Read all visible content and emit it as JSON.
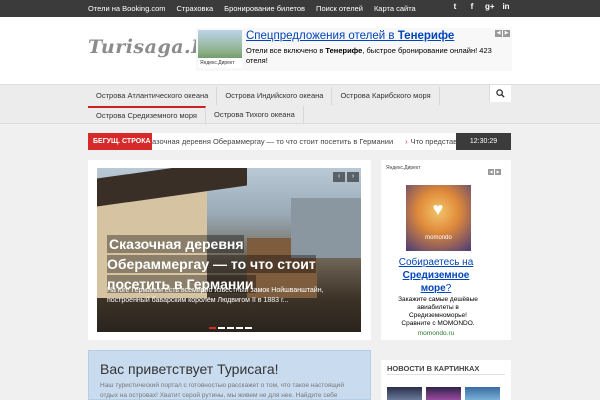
{
  "topbar": {
    "links": [
      "Отели на Booking.com",
      "Страховка",
      "Бронирование билетов",
      "Поиск отелей",
      "Карта сайта"
    ],
    "social": [
      "twitter-icon",
      "facebook-icon",
      "google-plus-icon",
      "linkedin-icon"
    ],
    "social_glyphs": [
      "t",
      "f",
      "g+",
      "in"
    ]
  },
  "logo": {
    "text": "Turisaga.Ru"
  },
  "header_ad": {
    "title_prefix": "Спецпредложения отелей в ",
    "title_bold": "Тенерифе",
    "text_1": "Отели все включено в ",
    "text_bold": "Тенерифе",
    "text_2": ", быстрое бронирование онлайн! 423 отеля!",
    "yandex_label": "Яндекс.Директ"
  },
  "nav": {
    "row1": [
      "Острова Атлантического океана",
      "Острова Индийского океана",
      "Острова Карибского моря"
    ],
    "row2": [
      "Острова Средиземного моря",
      "Острова Тихого океана"
    ]
  },
  "ticker": {
    "label": "БЕГУЩ. СТРОКА",
    "items": [
      "азочная деревня Обераммергау — то что стоит посетить в Германии",
      "Что представляет собой"
    ],
    "time": "12:30:29"
  },
  "slider": {
    "title": "Сказочная деревня Обераммергау — то что стоит посетить в Германии",
    "description": "На юге Германии есть всемирно известный замок Нойшванштайн, построенный баварским королём Людвигом II в 1883 г...",
    "prev": "‹",
    "next": "›",
    "active_dot": 1,
    "dot_count": 5
  },
  "side_ad": {
    "label": "Яндекс.Директ",
    "image_brand": "momondo",
    "title_1": "Собираетесь на ",
    "title_bold": "Средиземное море",
    "title_2": "?",
    "text": "Закажите самые дешёвые авиабилеты в Средиземноморье! Сравните с MOMONDO.",
    "domain": "momondo.ru"
  },
  "welcome": {
    "title": "Вас приветствует Турисага!",
    "text": "Наш туристический портал с готовностью расскажет о том, что такое настоящий отдых на островах! Хватит серой рутины, мы живем не для нее. Найдите себе"
  },
  "pictures": {
    "title": "НОВОСТИ В КАРТИНКАХ"
  },
  "colors": {
    "accent": "#d62a2a",
    "topbar": "#3b3b3b",
    "link": "#0044bb"
  }
}
